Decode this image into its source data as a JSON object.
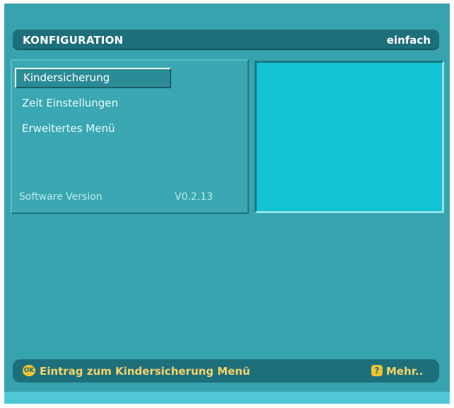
{
  "header": {
    "title": "KONFIGURATION",
    "mode": "einfach"
  },
  "menu": {
    "items": [
      {
        "label": "Kindersicherung",
        "selected": true
      },
      {
        "label": "Zeit Einstellungen",
        "selected": false
      },
      {
        "label": "Erweitertes Menü",
        "selected": false
      }
    ],
    "software_label": "Software Version",
    "software_version": "V0.2.13"
  },
  "footer": {
    "ok_icon_text": "OK",
    "hint": "Eintrag zum Kindersicherung Menü",
    "help_icon_text": "?",
    "more_label": "Mehr.."
  },
  "colors": {
    "background": "#36a3ae",
    "bar": "#1e6f7c",
    "preview": "#12c3d3",
    "hint_text": "#f3d46a",
    "key_icon": "#f1c232"
  }
}
